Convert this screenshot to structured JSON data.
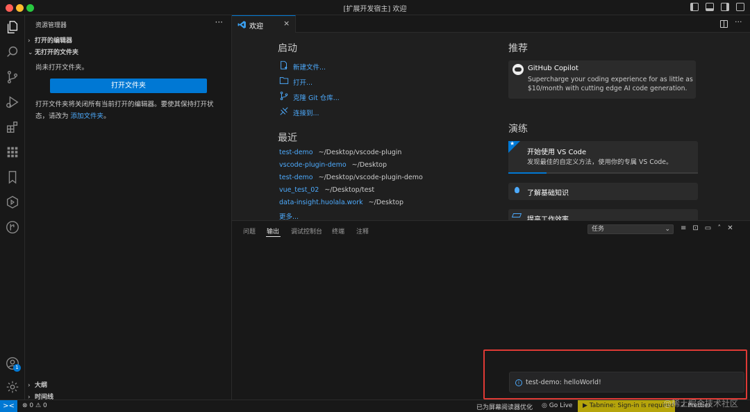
{
  "window": {
    "title": "[扩展开发宿主] 欢迎",
    "traffic_lights": [
      "#ff5f57",
      "#febc2e",
      "#28c840"
    ]
  },
  "sidebar": {
    "title": "资源管理器",
    "more": "···",
    "open_editors": "打开的编辑器",
    "no_folder_section": "无打开的文件夹",
    "no_folder_msg": "尚未打开文件夹。",
    "open_folder_btn": "打开文件夹",
    "hint_line1": "打开文件夹将关闭所有当前打开的编辑器。要使其保持打开状",
    "hint_line2_prefix": "态，请改为",
    "hint_link": "添加文件夹",
    "hint_suffix": "。",
    "outline": "大纲",
    "timeline": "时间线"
  },
  "tab": {
    "label": "欢迎",
    "close": "×"
  },
  "welcome": {
    "start_title": "启动",
    "start_items": [
      "新建文件...",
      "打开...",
      "克隆 Git 仓库...",
      "连接到..."
    ],
    "recent_title": "最近",
    "recent": [
      {
        "name": "test-demo",
        "path": "~/Desktop/vscode-plugin"
      },
      {
        "name": "vscode-plugin-demo",
        "path": "~/Desktop"
      },
      {
        "name": "test-demo",
        "path": "~/Desktop/vscode-plugin-demo"
      },
      {
        "name": "vue_test_02",
        "path": "~/Desktop/test"
      },
      {
        "name": "data-insight.huolala.work",
        "path": "~/Desktop"
      }
    ],
    "more": "更多...",
    "recommend_title": "推荐",
    "copilot_title": "GitHub Copilot",
    "copilot_desc1": "Supercharge your coding experience for as little as",
    "copilot_desc2": "$10/month with cutting edge AI code generation.",
    "walkthrough_title": "演练",
    "walk1_title": "开始使用 VS Code",
    "walk1_desc": "发现最佳的自定义方法，使用你的专属 VS Code。",
    "walk2_title": "了解基础知识",
    "walk3_title": "提高工作效率"
  },
  "panel": {
    "tabs": [
      "问题",
      "输出",
      "调试控制台",
      "终端",
      "注释"
    ],
    "active_tab": "输出",
    "select_value": "任务"
  },
  "notification": {
    "text": "test-demo: helloWorld!"
  },
  "statusbar": {
    "remote_icon": "><",
    "errors": "0",
    "warnings": "0",
    "screen_reader": "已为屏幕阅读器优化",
    "go_live": "Go Live",
    "tabnine": "Tabnine: Sign-in is required!",
    "prettier": "Prettier"
  },
  "activity": {
    "accounts_badge": "1"
  },
  "watermark": "@稀土掘金技术社区"
}
